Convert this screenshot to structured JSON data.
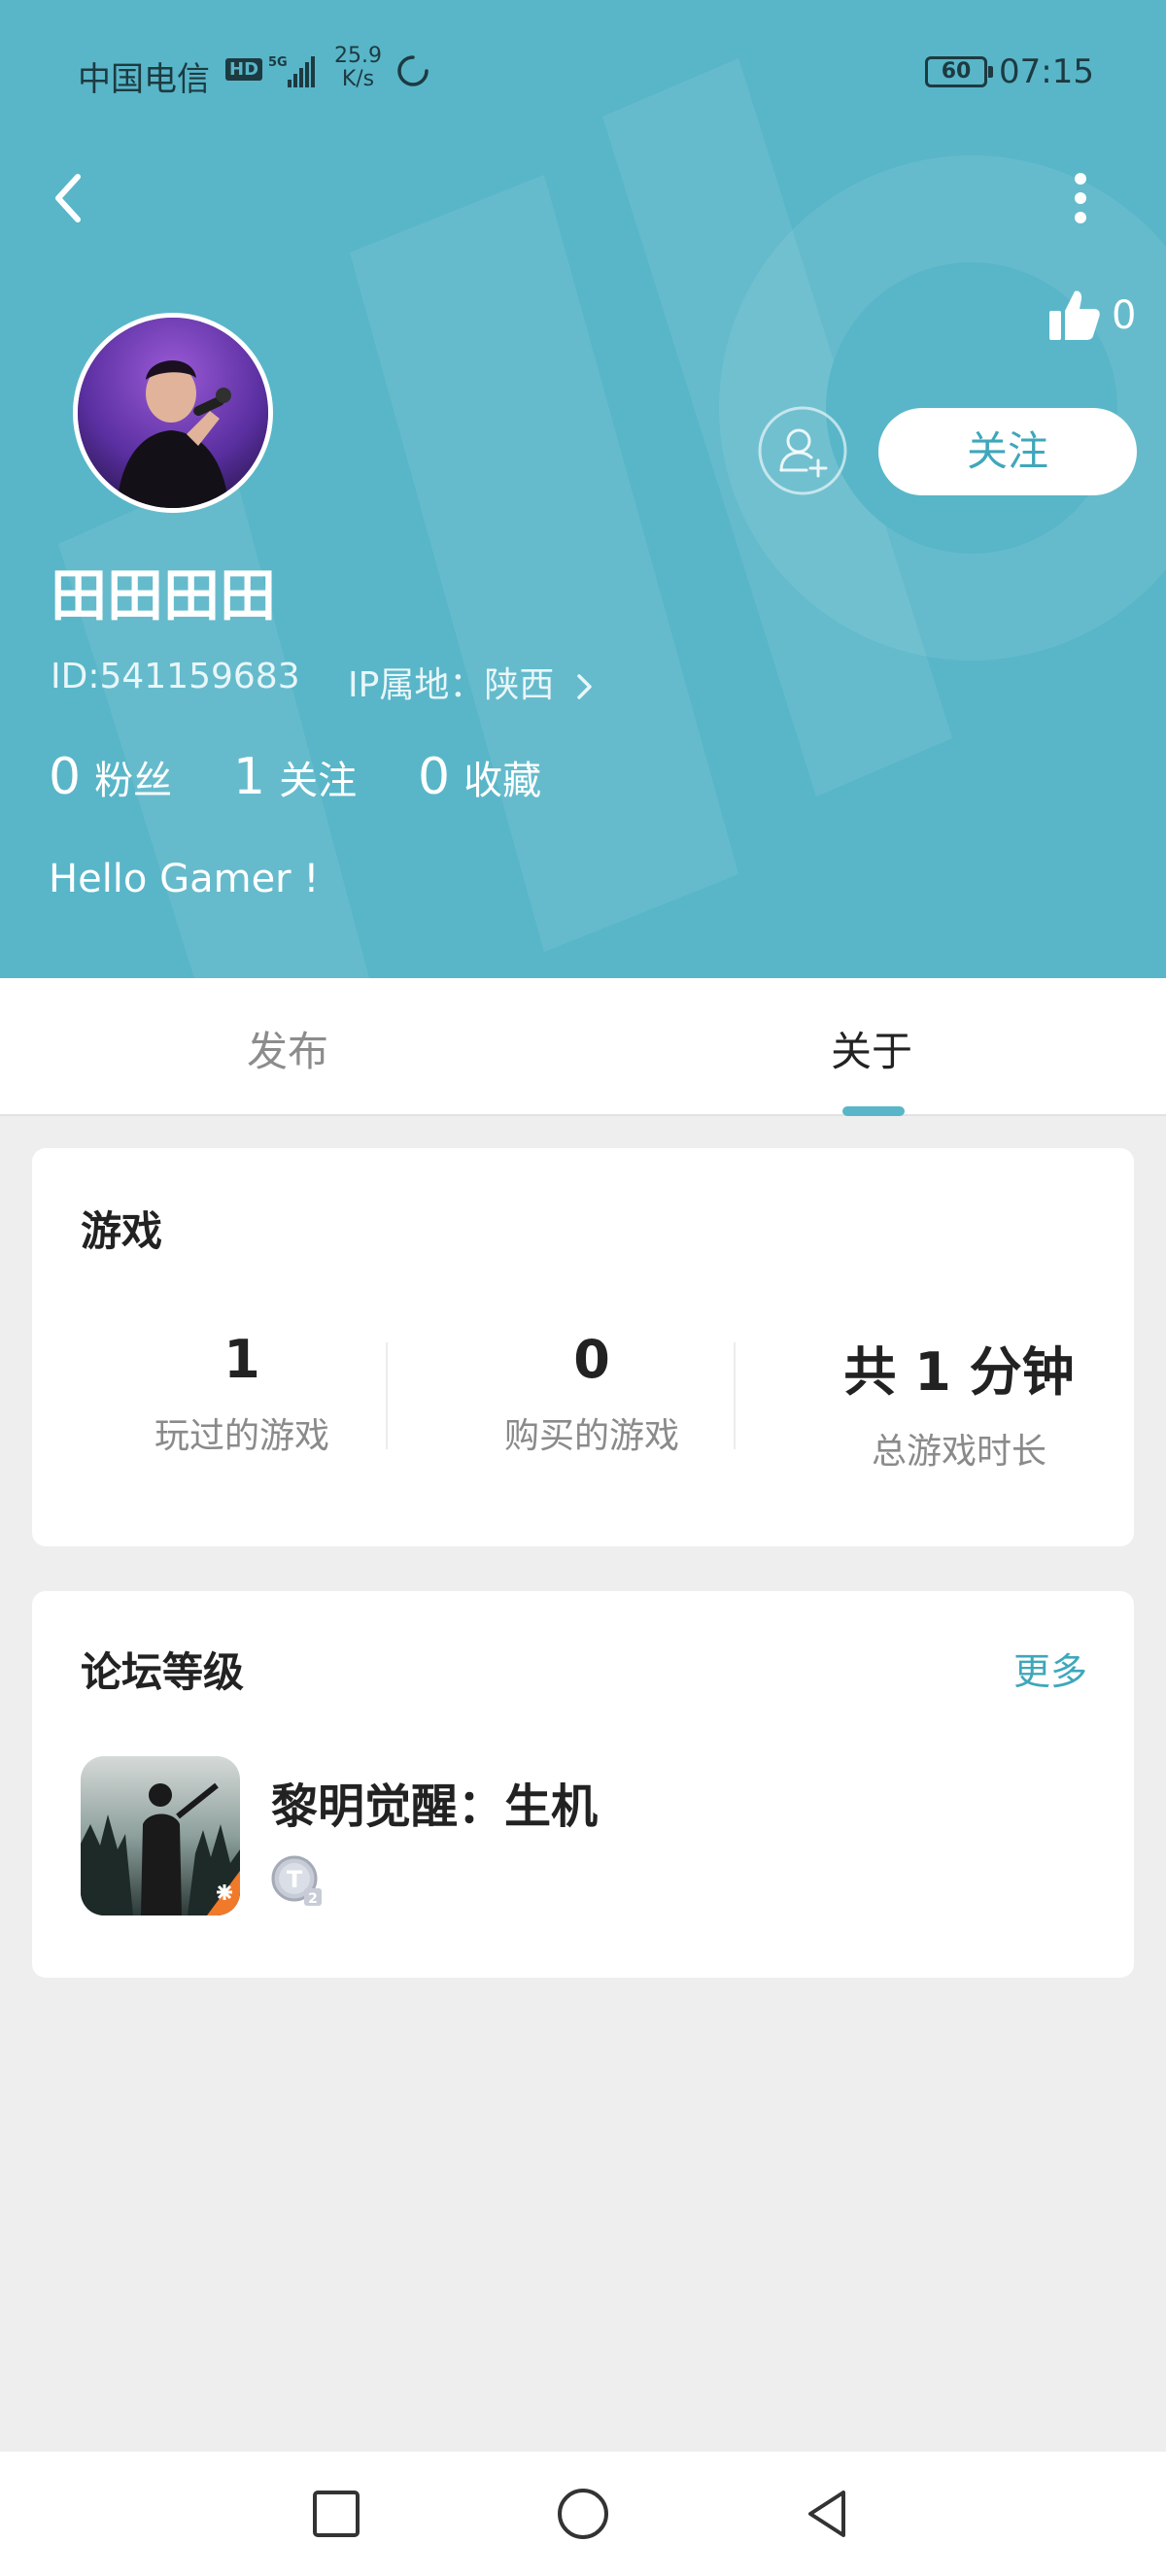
{
  "status_bar": {
    "carrier": "中国电信",
    "hd": "HD",
    "network": "5G",
    "speed_value": "25.9",
    "speed_unit": "K/s",
    "battery": "60",
    "time": "07:15"
  },
  "header": {
    "like_count": "0",
    "follow_label": "关注",
    "username": "田田田田",
    "id_text": "ID:541159683",
    "ip_text": "IP属地：陕西",
    "stats": [
      {
        "value": "0",
        "label": "粉丝"
      },
      {
        "value": "1",
        "label": "关注"
      },
      {
        "value": "0",
        "label": "收藏"
      }
    ],
    "bio": "Hello Gamer !"
  },
  "tabs": [
    {
      "label": "发布",
      "active": false
    },
    {
      "label": "关于",
      "active": true
    }
  ],
  "games_card": {
    "title": "游戏",
    "stats": [
      {
        "value": "1",
        "label": "玩过的游戏"
      },
      {
        "value": "0",
        "label": "购买的游戏"
      },
      {
        "value": "共 1 分钟",
        "label": "总游戏时长"
      }
    ]
  },
  "forum_card": {
    "title": "论坛等级",
    "more_label": "更多",
    "game_name": "黎明觉醒：生机",
    "badge_text": "T",
    "badge_level": "2"
  },
  "colors": {
    "header_bg": "#58b6c8",
    "accent": "#3fa7bb",
    "page_bg": "#eeeeee"
  },
  "icons": [
    "back-icon",
    "more-vertical-icon",
    "thumbs-up-icon",
    "add-friend-icon",
    "chevron-right-icon",
    "nav-square-icon",
    "nav-circle-icon",
    "nav-back-triangle-icon"
  ]
}
